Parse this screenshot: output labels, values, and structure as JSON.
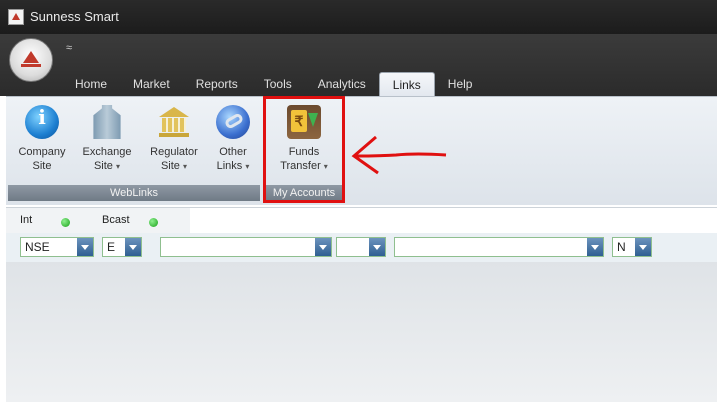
{
  "window": {
    "title": "Sunness Smart"
  },
  "quick_access": {
    "symbol": "≈"
  },
  "tabs": [
    {
      "label": "Home"
    },
    {
      "label": "Market"
    },
    {
      "label": "Reports"
    },
    {
      "label": "Tools"
    },
    {
      "label": "Analytics"
    },
    {
      "label": "Links",
      "active": true
    },
    {
      "label": "Help"
    }
  ],
  "ribbon": {
    "weblinks": {
      "group_label": "WebLinks",
      "buttons": [
        {
          "line1": "Company",
          "line2": "Site",
          "icon": "info-icon"
        },
        {
          "line1": "Exchange",
          "line2": "Site",
          "dropdown": "▾",
          "icon": "exchange-building-icon"
        },
        {
          "line1": "Regulator",
          "line2": "Site",
          "dropdown": "▾",
          "icon": "regulator-building-icon"
        },
        {
          "line1": "Other",
          "line2": "Links",
          "dropdown": "▾",
          "icon": "globe-link-icon"
        }
      ]
    },
    "accounts": {
      "group_label": "My Accounts",
      "buttons": [
        {
          "line1": "Funds",
          "line2": "Transfer",
          "dropdown": "▾",
          "icon": "funds-transfer-icon"
        }
      ]
    }
  },
  "status": {
    "int_label": "Int",
    "bcast_label": "Bcast",
    "led_color": "#18a018"
  },
  "filters": {
    "exchange": "NSE",
    "segment": "E",
    "instrument": "",
    "series": "",
    "symbol": "",
    "option": "N"
  },
  "annotation": {
    "highlight_color": "#e01010"
  }
}
